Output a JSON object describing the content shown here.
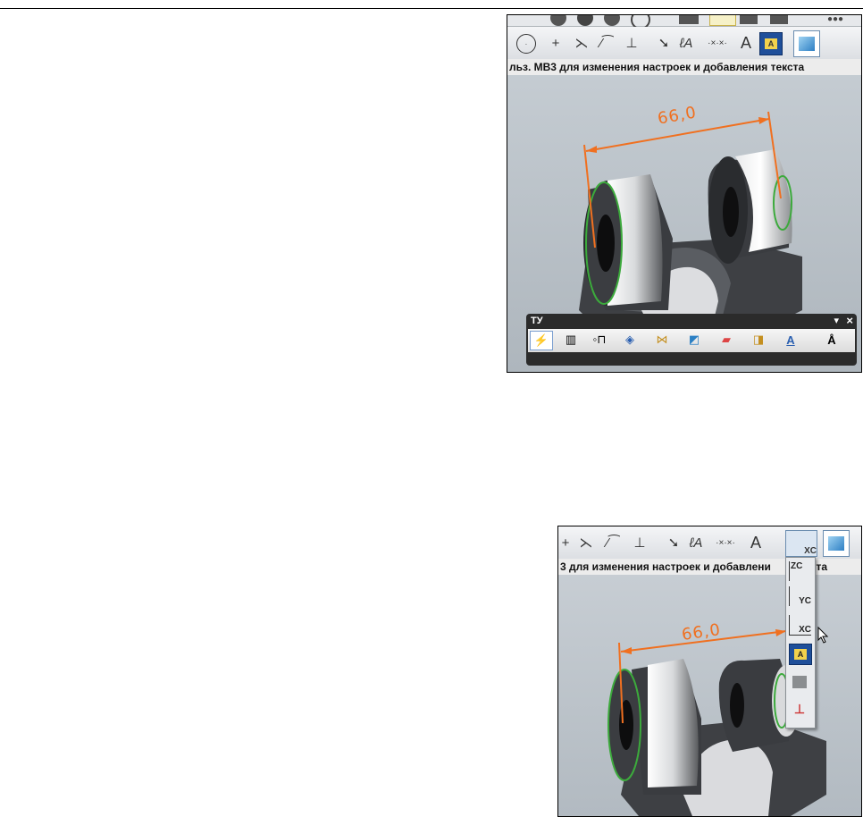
{
  "shot1": {
    "status_text": "льз. MB3 для изменения настроек и добавления текста",
    "dimension_label": "66,0",
    "panel_title": "ТУ",
    "panel_close": "×",
    "panel_menu": "▾"
  },
  "shot2": {
    "status_text": "3 для изменения настроек и добавлени",
    "status_tail": "кста",
    "dimension_label": "66,0",
    "active_tool_label": "XC",
    "dropdown_items": [
      {
        "label": "ZC"
      },
      {
        "label": "YC"
      },
      {
        "label": "XC"
      },
      {
        "label": ""
      },
      {
        "label": ""
      },
      {
        "label": ""
      }
    ]
  },
  "colors": {
    "dimension": "#f07020",
    "edge_highlight": "#3caa3c",
    "viewport": "#bfc6cc"
  }
}
